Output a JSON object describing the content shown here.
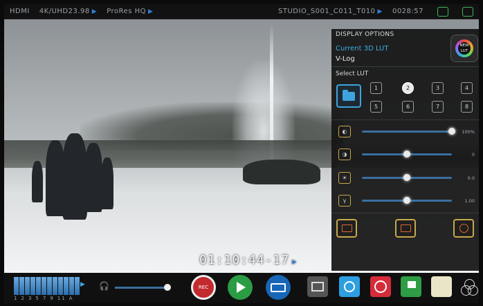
{
  "topbar": {
    "input": "HDMI",
    "resolution": "4K/UHD23.98",
    "codec": "ProRes HQ",
    "clip": "STUDIO_S001_C011_T010",
    "disk": "0028:57"
  },
  "timecode": "01:10:44-17",
  "display_options": {
    "heading": "DISPLAY OPTIONS",
    "current_lut_label": "Current 3D LUT",
    "current_lut_value": "V-Log",
    "lut_button_label": "NEW LUT",
    "select_lut_label": "Select LUT",
    "lut_slots": [
      "1",
      "2",
      "3",
      "4",
      "5",
      "6",
      "7",
      "8"
    ],
    "active_slot": "2",
    "sliders": [
      {
        "name": "brightness",
        "level": 1.0,
        "value": "100%"
      },
      {
        "name": "contrast",
        "level": 0.5,
        "value": "0"
      },
      {
        "name": "exposure",
        "level": 0.5,
        "value": "0.0"
      },
      {
        "name": "gamma",
        "level": 0.5,
        "value": "1.00"
      }
    ]
  },
  "audio": {
    "channel_labels": "1 2 3 5 7 9 11 A",
    "volume_level": 1.0
  },
  "transport": {
    "rec_label": "REC"
  },
  "colors": {
    "accent": "#2f7fd6",
    "record": "#c22a2f",
    "play": "#2a9d44",
    "monitor": "#1866b8"
  }
}
